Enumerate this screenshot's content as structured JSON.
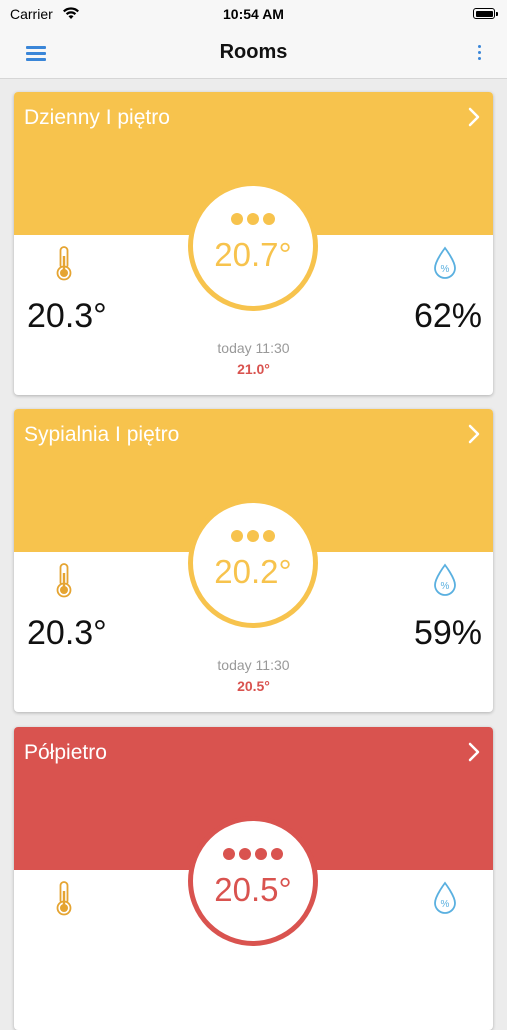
{
  "status_bar": {
    "carrier": "Carrier",
    "time": "10:54 AM"
  },
  "nav": {
    "title": "Rooms",
    "menu_icon": "hamburger-menu-icon",
    "more_icon": "vertical-ellipsis-icon"
  },
  "colors": {
    "yellow": "#f7c34d",
    "red": "#d9534f",
    "blue": "#3a86d8",
    "humidity_blue": "#5ab0e0"
  },
  "rooms": [
    {
      "name": "Dzienny I piętro",
      "header_color": "#f7c34d",
      "dial_color": "#f7c34d",
      "dots": 3,
      "dial_temp": "20.7°",
      "measured_temp": "20.3°",
      "humidity": "62%",
      "updated": "today 11:30",
      "setpoint": "21.0°"
    },
    {
      "name": "Sypialnia I piętro",
      "header_color": "#f7c34d",
      "dial_color": "#f7c34d",
      "dots": 3,
      "dial_temp": "20.2°",
      "measured_temp": "20.3°",
      "humidity": "59%",
      "updated": "today 11:30",
      "setpoint": "20.5°"
    },
    {
      "name": "Półpietro",
      "header_color": "#d9534f",
      "dial_color": "#d9534f",
      "dots": 4,
      "dial_temp": "20.5°"
    }
  ]
}
